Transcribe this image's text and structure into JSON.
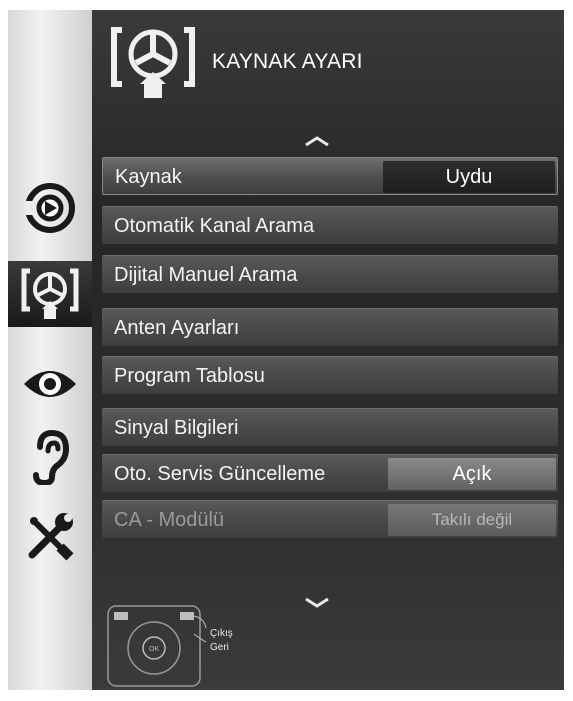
{
  "header": {
    "title": "KAYNAK AYARI",
    "icon": "source-settings-icon"
  },
  "menu": {
    "items": [
      {
        "label": "Kaynak",
        "value": "Uydu"
      },
      {
        "label": "Otomatik Kanal Arama"
      },
      {
        "label": "Dijital Manuel Arama"
      },
      {
        "label": "Anten Ayarları"
      },
      {
        "label": "Program Tablosu"
      },
      {
        "label": "Sinyal Bilgileri"
      },
      {
        "label": "Oto. Servis Güncelleme",
        "value": "Açık"
      },
      {
        "label": "CA - Modülü",
        "value": "Takılı değil"
      }
    ],
    "selected_index": 0
  },
  "sidebar": {
    "icons": [
      "source-input-icon",
      "source-settings-icon",
      "picture-eye-icon",
      "audio-ear-icon",
      "tools-icon"
    ],
    "active_index": 1
  },
  "footer": {
    "exit_label": "Çıkış",
    "back_label": "Geri",
    "remote_icon": "remote-control-icon"
  },
  "colors": {
    "panel": "#2b2b2b",
    "item": "#4a4a4a",
    "text": "#f4f4f4",
    "disabled_text": "#9a9a9a",
    "rail": "#e0e0e0"
  }
}
